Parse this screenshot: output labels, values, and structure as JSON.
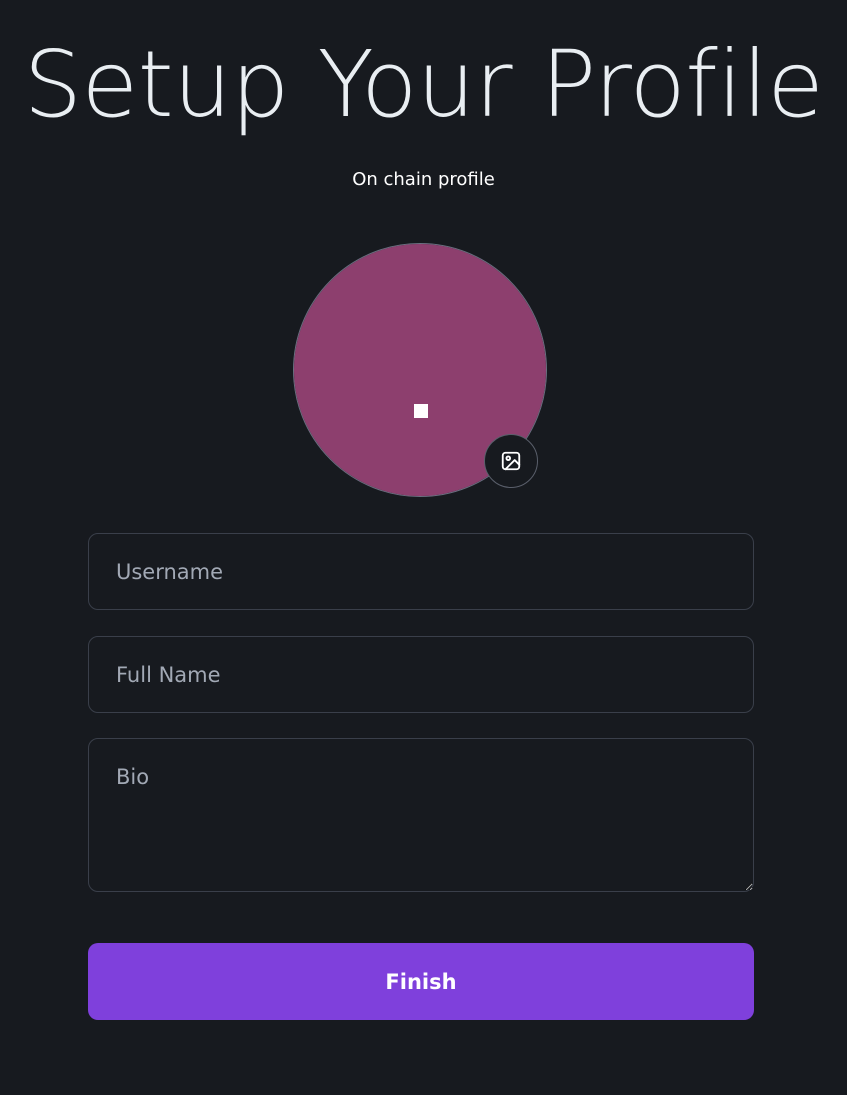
{
  "header": {
    "title": "Setup Your Profile",
    "subtitle": "On chain profile"
  },
  "avatar": {
    "color": "#8d3f6e",
    "upload_icon": "image-icon"
  },
  "form": {
    "username_placeholder": "Username",
    "username_value": "",
    "fullname_placeholder": "Full Name",
    "fullname_value": "",
    "bio_placeholder": "Bio",
    "bio_value": ""
  },
  "actions": {
    "finish_label": "Finish",
    "finish_color": "#7f40dc"
  }
}
